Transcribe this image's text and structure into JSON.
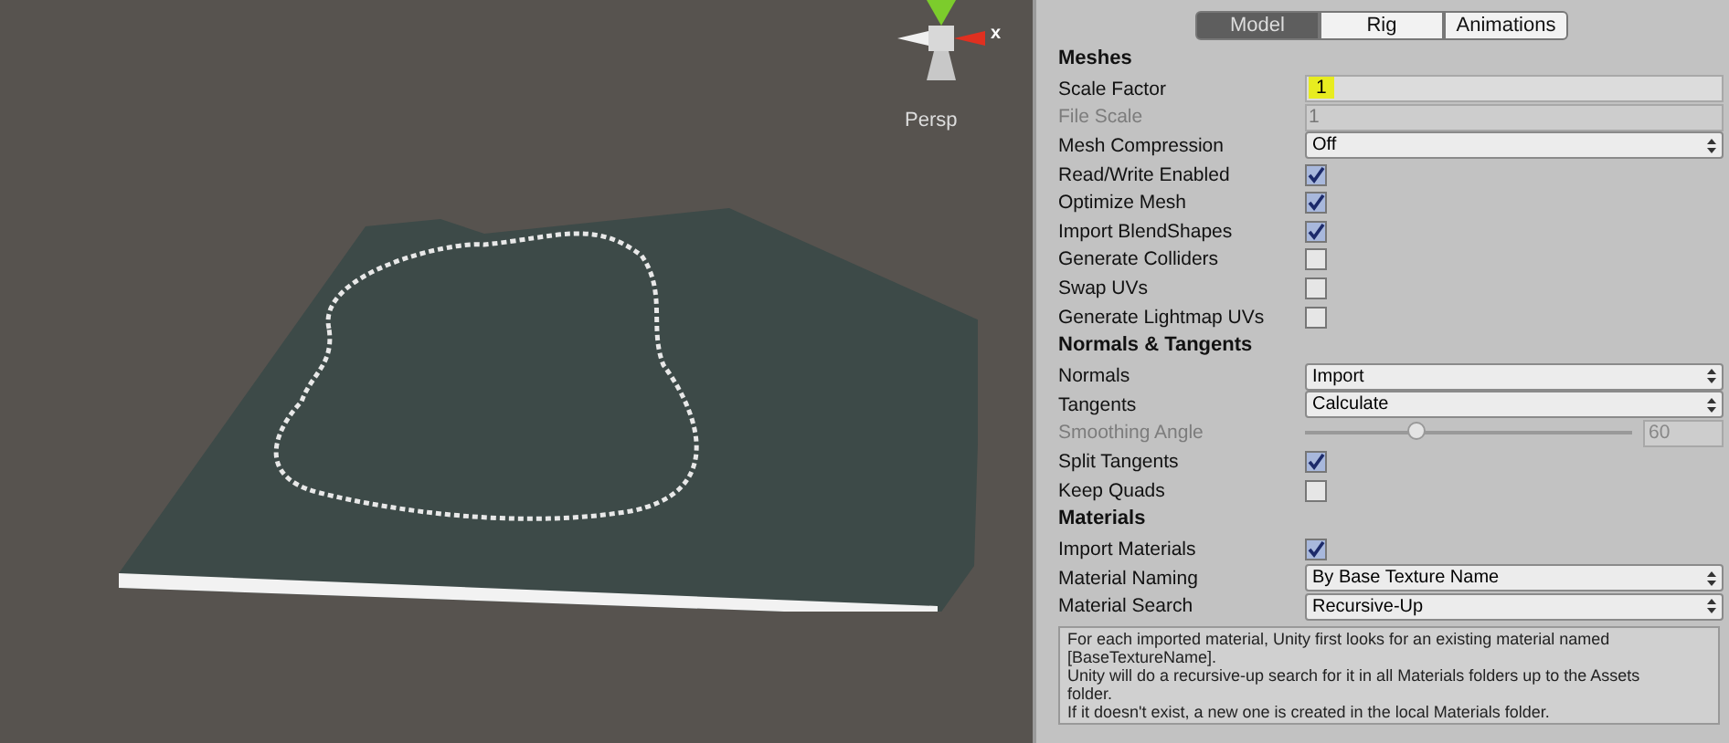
{
  "scene": {
    "gizmo_axis_label": "x",
    "projection": "Persp"
  },
  "inspector": {
    "tabs": [
      {
        "label": "Model",
        "selected": true
      },
      {
        "label": "Rig",
        "selected": false
      },
      {
        "label": "Animations",
        "selected": false
      }
    ],
    "sections": [
      {
        "title": "Meshes",
        "rows": [
          {
            "kind": "text",
            "label": "Scale Factor",
            "value": "1",
            "disabled": false,
            "highlighted": true
          },
          {
            "kind": "text",
            "label": "File Scale",
            "value": "1",
            "disabled": true,
            "highlighted": false
          },
          {
            "kind": "dropdown",
            "label": "Mesh Compression",
            "value": "Off",
            "disabled": false
          },
          {
            "kind": "checkbox",
            "label": "Read/Write Enabled",
            "checked": true,
            "disabled": false
          },
          {
            "kind": "checkbox",
            "label": "Optimize Mesh",
            "checked": true,
            "disabled": false
          },
          {
            "kind": "checkbox",
            "label": "Import BlendShapes",
            "checked": true,
            "disabled": false
          },
          {
            "kind": "checkbox",
            "label": "Generate Colliders",
            "checked": false,
            "disabled": false
          },
          {
            "kind": "checkbox",
            "label": "Swap UVs",
            "checked": false,
            "disabled": false
          },
          {
            "kind": "checkbox",
            "label": "Generate Lightmap UVs",
            "checked": false,
            "disabled": false
          }
        ]
      },
      {
        "title": "Normals & Tangents",
        "rows": [
          {
            "kind": "dropdown",
            "label": "Normals",
            "value": "Import",
            "disabled": false
          },
          {
            "kind": "dropdown",
            "label": "Tangents",
            "value": "Calculate",
            "disabled": false
          },
          {
            "kind": "slider",
            "label": "Smoothing Angle",
            "level": 0.34,
            "value": "60",
            "disabled": true
          },
          {
            "kind": "checkbox",
            "label": "Split Tangents",
            "checked": true,
            "disabled": false
          },
          {
            "kind": "checkbox",
            "label": "Keep Quads",
            "checked": false,
            "disabled": false
          }
        ]
      },
      {
        "title": "Materials",
        "rows": [
          {
            "kind": "checkbox",
            "label": "Import Materials",
            "checked": true,
            "disabled": false
          },
          {
            "kind": "dropdown",
            "label": "Material Naming",
            "value": "By Base Texture Name",
            "disabled": false
          },
          {
            "kind": "dropdown",
            "label": "Material Search",
            "value": "Recursive-Up",
            "disabled": false
          }
        ]
      }
    ],
    "help_lines": [
      "For each imported material, Unity first looks for an existing material named",
      "[BaseTextureName].",
      "Unity will do a recursive-up search for it in all Materials folders up to the Assets",
      "folder.",
      "If it doesn't exist, a new one is created in the local Materials folder."
    ]
  }
}
